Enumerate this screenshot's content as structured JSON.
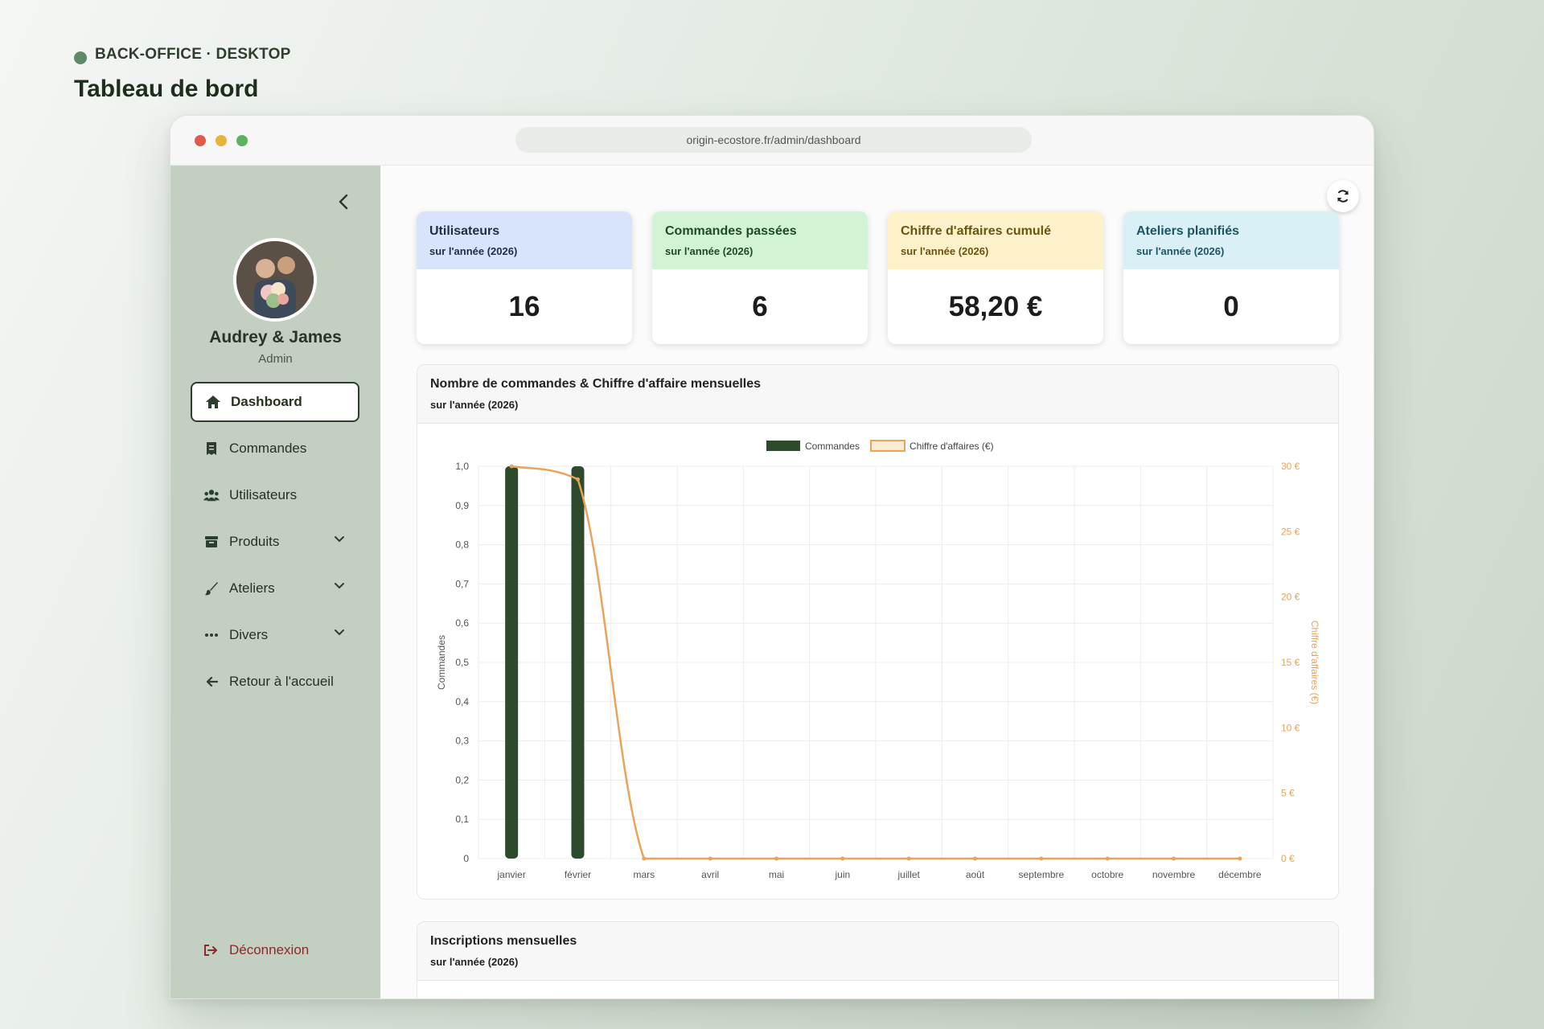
{
  "page": {
    "eyebrow": "BACK-OFFICE · DESKTOP",
    "title": "Tableau de bord"
  },
  "browser": {
    "url": "origin-ecostore.fr/admin/dashboard"
  },
  "user": {
    "name": "Audrey & James",
    "role": "Admin"
  },
  "sidebar": {
    "items": [
      {
        "label": "Dashboard",
        "icon": "home-icon",
        "active": true
      },
      {
        "label": "Commandes",
        "icon": "receipt-icon"
      },
      {
        "label": "Utilisateurs",
        "icon": "users-icon"
      },
      {
        "label": "Produits",
        "icon": "box-icon",
        "expandable": true
      },
      {
        "label": "Ateliers",
        "icon": "brush-icon",
        "expandable": true
      },
      {
        "label": "Divers",
        "icon": "ellipsis-icon",
        "expandable": true
      },
      {
        "label": "Retour à l'accueil",
        "icon": "arrow-left-icon"
      }
    ],
    "logout": "Déconnexion"
  },
  "stats": [
    {
      "label": "Utilisateurs",
      "sub": "sur l'année (2026)",
      "value": "16",
      "head_bg": "#d8e4fb",
      "color": "#1e2d4a"
    },
    {
      "label": "Commandes passées",
      "sub": "sur l'année (2026)",
      "value": "6",
      "head_bg": "#d3f3d6",
      "color": "#1f4a26"
    },
    {
      "label": "Chiffre d'affaires cumulé",
      "sub": "sur l'année (2026)",
      "value": "58,20 €",
      "head_bg": "#fcf1c9",
      "color": "#6b5410"
    },
    {
      "label": "Ateliers planifiés",
      "sub": "sur l'année (2026)",
      "value": "0",
      "head_bg": "#d8f0f6",
      "color": "#1d5563"
    }
  ],
  "chart_panel": {
    "title": "Nombre de commandes & Chiffre d'affaire mensuelles",
    "sub": "sur l'année (2026)"
  },
  "signup_panel": {
    "title": "Inscriptions mensuelles",
    "sub": "sur l'année (2026)"
  },
  "chart_data": {
    "type": "bar",
    "categories": [
      "janvier",
      "février",
      "mars",
      "avril",
      "mai",
      "juin",
      "juillet",
      "août",
      "septembre",
      "octobre",
      "novembre",
      "décembre"
    ],
    "series": [
      {
        "name": "Commandes",
        "type": "bar",
        "axis": "left",
        "color": "#2d4a2b",
        "values": [
          1,
          1,
          0,
          0,
          0,
          0,
          0,
          0,
          0,
          0,
          0,
          0
        ]
      },
      {
        "name": "Chiffre d'affaires (€)",
        "type": "line",
        "axis": "right",
        "color": "#e9a35b",
        "values": [
          30,
          29,
          0,
          0,
          0,
          0,
          0,
          0,
          0,
          0,
          0,
          0
        ]
      }
    ],
    "ylabel": "Commandes",
    "y2label": "Chiffre d'affaires (€)",
    "ylim": [
      0,
      1
    ],
    "y2lim": [
      0,
      30
    ],
    "yticks": [
      "0",
      "0,1",
      "0,2",
      "0,3",
      "0,4",
      "0,5",
      "0,6",
      "0,7",
      "0,8",
      "0,9",
      "1,0"
    ],
    "y2ticks": [
      "0 €",
      "5 €",
      "10 €",
      "15 €",
      "20 €",
      "25 €",
      "30 €"
    ],
    "grid": true,
    "legend": "top-center"
  }
}
